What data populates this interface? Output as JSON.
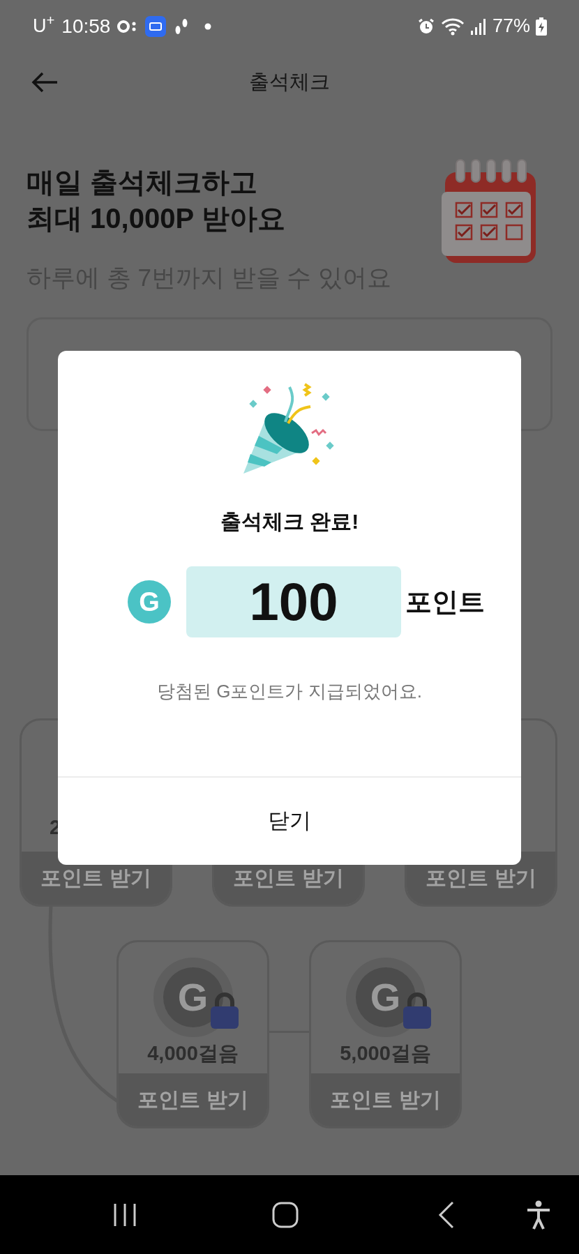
{
  "status_bar": {
    "carrier": "U$^{+}$",
    "time": "10:58",
    "battery": "77%"
  },
  "header": {
    "title": "출석체크"
  },
  "hero": {
    "title_lines": [
      "매일 출석체크하고",
      "최대 10,000P 받아요"
    ],
    "subtitle": "하루에 총 7번까지 받을 수 있어요"
  },
  "step_rows": [
    [
      {
        "steps": "2",
        "button": "포인트 받기",
        "disabled": true
      },
      {
        "button": "포인트 받기",
        "disabled": true
      },
      {
        "button": "포인트 받기",
        "disabled": true
      }
    ],
    [
      {
        "coin": "G",
        "locked": true,
        "steps": "4,000걸음",
        "button": "포인트 받기",
        "disabled": true
      },
      {
        "coin": "G",
        "locked": true,
        "steps": "5,000걸음",
        "button": "포인트 받기",
        "disabled": true
      }
    ]
  ],
  "dialog": {
    "title": "출석체크 완료!",
    "coin": "G",
    "points": "100",
    "unit": "포인트",
    "message": "당첨된 G포인트가 지급되었어요.",
    "close": "닫기"
  }
}
